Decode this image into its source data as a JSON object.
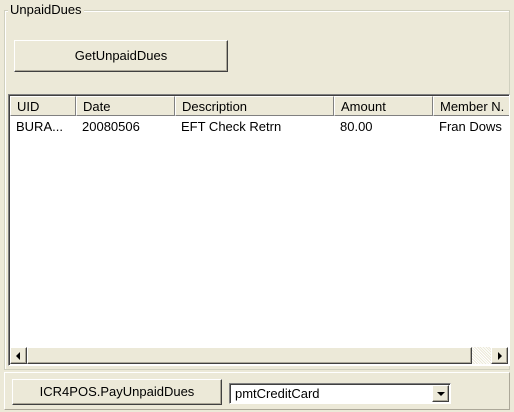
{
  "groupbox": {
    "title": "UnpaidDues"
  },
  "buttons": {
    "get_unpaid_dues": "GetUnpaidDues",
    "pay_unpaid_dues": "ICR4POS.PayUnpaidDues"
  },
  "table": {
    "columns": [
      "UID",
      "Date",
      "Description",
      "Amount",
      "Member N."
    ],
    "rows": [
      [
        "BURA...",
        "20080506",
        "EFT Check Retrn",
        "80.00",
        "Fran Dows"
      ]
    ]
  },
  "payment_combo": {
    "selected": "pmtCreditCard"
  },
  "icons": {
    "scroll_left": "left-arrow-icon",
    "scroll_right": "right-arrow-icon",
    "dropdown": "chevron-down-icon"
  },
  "colors": {
    "background": "#ECE9D8",
    "list_background": "#FFFFFF"
  }
}
